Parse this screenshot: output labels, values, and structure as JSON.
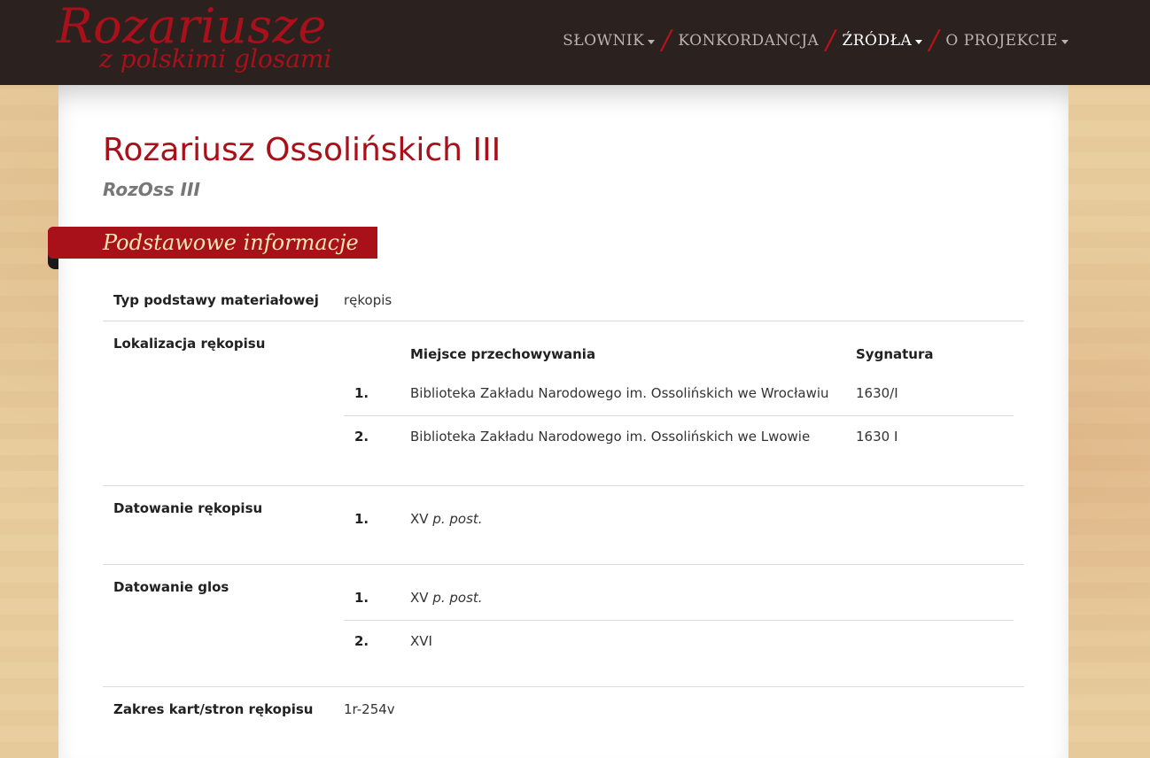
{
  "logo": {
    "main": "Rozariusze",
    "sub": "z polskimi glosami"
  },
  "nav": {
    "items": [
      {
        "label": "SŁOWNIK",
        "dropdown": true,
        "active": false
      },
      {
        "label": "KONKORDANCJA",
        "dropdown": false,
        "active": false
      },
      {
        "label": "ŹRÓDŁA",
        "dropdown": true,
        "active": true
      },
      {
        "label": "O PROJEKCIE",
        "dropdown": true,
        "active": false
      }
    ],
    "separator": "/"
  },
  "page": {
    "title": "Rozariusz Ossolińskich III",
    "subtitle": "RozOss III"
  },
  "section": {
    "title": "Podstawowe informacje"
  },
  "info": {
    "typ": {
      "label": "Typ podstawy materiałowej",
      "value": "rękopis"
    },
    "lokalizacja": {
      "label": "Lokalizacja rękopisu",
      "col_place": "Miejsce przechowywania",
      "col_sig": "Sygnatura",
      "rows": [
        {
          "num": "1.",
          "place": "Biblioteka Zakładu Narodowego im. Ossolińskich we Wrocławiu",
          "sig": "1630/I"
        },
        {
          "num": "2.",
          "place": "Biblioteka Zakładu Narodowego im. Ossolińskich we Lwowie",
          "sig": "1630 I"
        }
      ]
    },
    "datowanie_rekopisu": {
      "label": "Datowanie rękopisu",
      "rows": [
        {
          "num": "1.",
          "century": "XV",
          "qualifier": "p. post."
        }
      ]
    },
    "datowanie_glos": {
      "label": "Datowanie glos",
      "rows": [
        {
          "num": "1.",
          "century": "XV",
          "qualifier": "p. post."
        },
        {
          "num": "2.",
          "century": "XVI",
          "qualifier": ""
        }
      ]
    },
    "zakres": {
      "label": "Zakres kart/stron rękopisu",
      "value": "1r-254v"
    }
  },
  "colors": {
    "brand_red": "#a8101a",
    "topbar": "#2b2220",
    "section_text": "#f4e7b3"
  }
}
